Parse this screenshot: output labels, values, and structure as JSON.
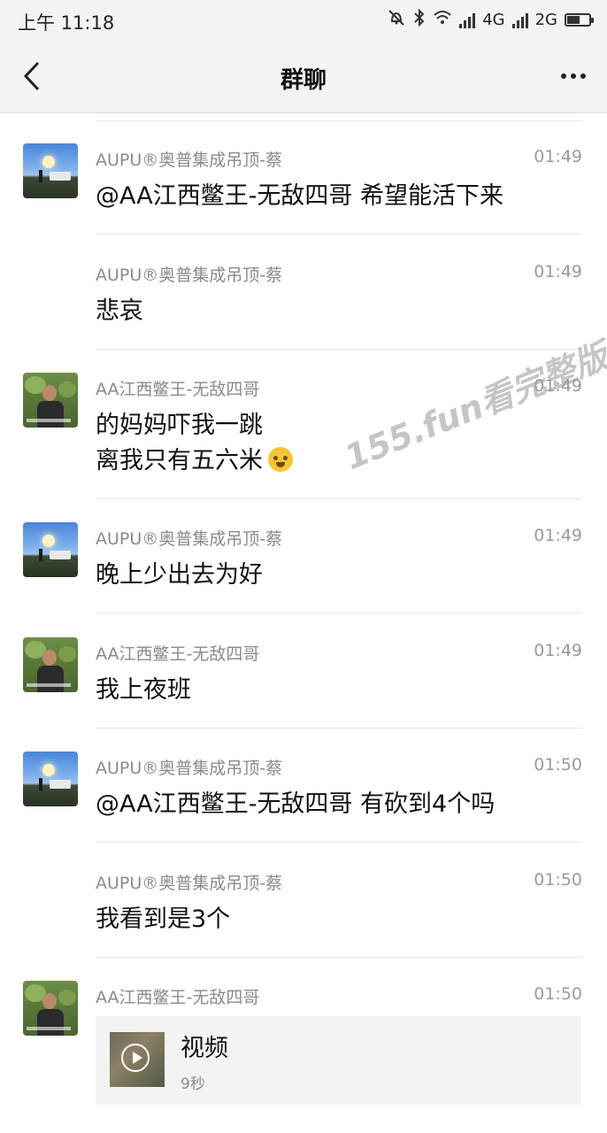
{
  "status_bar": {
    "time": "上午 11:18",
    "network1": "4G",
    "network2": "2G",
    "battery_level": 0.6
  },
  "nav": {
    "title": "群聊"
  },
  "messages": [
    {
      "sender": "AUPU®奥普集成吊顶-蔡",
      "time": "01:49",
      "lines": [
        "@AA江西鳖王-无敌四哥 希望能活下来"
      ]
    },
    {
      "sender": "AUPU®奥普集成吊顶-蔡",
      "time": "01:49",
      "lines": [
        "悲哀"
      ]
    },
    {
      "sender": "AA江西鳖王-无敌四哥",
      "time": "01:49",
      "lines": [
        "的妈妈吓我一跳",
        "离我只有五六米"
      ]
    },
    {
      "sender": "AUPU®奥普集成吊顶-蔡",
      "time": "01:49",
      "lines": [
        "晚上少出去为好"
      ]
    },
    {
      "sender": "AA江西鳖王-无敌四哥",
      "time": "01:49",
      "lines": [
        "我上夜班"
      ]
    },
    {
      "sender": "AUPU®奥普集成吊顶-蔡",
      "time": "01:50",
      "lines": [
        "@AA江西鳖王-无敌四哥 有砍到4个吗"
      ]
    },
    {
      "sender": "AUPU®奥普集成吊顶-蔡",
      "time": "01:50",
      "lines": [
        "我看到是3个"
      ]
    },
    {
      "sender": "AA江西鳖王-无敌四哥",
      "time": "01:50",
      "video": {
        "title": "视频",
        "duration": "9秒"
      }
    }
  ],
  "watermark": "155.fun看完整版"
}
